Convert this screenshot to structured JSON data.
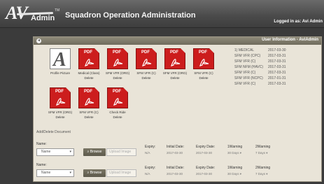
{
  "header": {
    "logo_big": "AV",
    "logo_small": "Admin",
    "logo_tm": "TM",
    "app_title": "Squadron Operation Administration",
    "login_text": "Logged in as: Avi Admin"
  },
  "panel": {
    "title": "User Information - AviAdmin",
    "control_glyph": "◂"
  },
  "documents": [
    {
      "label": "Profile Picture",
      "kind": "photo",
      "delete": ""
    },
    {
      "label": "Medical (Class)",
      "kind": "pdf",
      "delete": "Delete"
    },
    {
      "label": "SFM VFR (ORG)",
      "kind": "pdf",
      "delete": "Delete"
    },
    {
      "label": "SFM VFR (C)",
      "kind": "pdf",
      "delete": "Delete"
    },
    {
      "label": "SFM VFR (ORG)",
      "kind": "pdf",
      "delete": "Delete"
    },
    {
      "label": "SFM VFR (C)",
      "kind": "pdf",
      "delete": "Delete"
    },
    {
      "label": "SFM VFR (ORG)",
      "kind": "pdf",
      "delete": "Delete"
    },
    {
      "label": "SFM VFR (C)",
      "kind": "pdf",
      "delete": "Delete"
    },
    {
      "label": "Check Ride",
      "kind": "pdf",
      "delete": "Delete"
    }
  ],
  "pdf_tag": "PDF",
  "info_rows": [
    {
      "k": "1) MEDICAL",
      "v": "2017-03-30"
    },
    {
      "k": "SFM VFR (CPC)",
      "v": "2017-03-31"
    },
    {
      "k": "SFM VFR (C)",
      "v": "2017-03-31"
    },
    {
      "k": "SFM NFM (HAVC)",
      "v": "2017-03-31"
    },
    {
      "k": "SFM VFR (C)",
      "v": "2017-03-31"
    },
    {
      "k": "SFM VFR (NCPC)",
      "v": "2017-01-31"
    },
    {
      "k": "SFM VFR (C)",
      "v": "2017-03-31"
    }
  ],
  "section_label": "Add/Delete Document",
  "form_rows": [
    {
      "name_label": "Name:",
      "select_value": "Name",
      "browse_label": "Browse",
      "upload_placeholder": "Upload Image",
      "expiry_label": "Expiry:",
      "expiry_value": "N/A",
      "initial_label": "Initial Date:",
      "initial_value": "2017-03-30",
      "expiry_date_label": "Expiry Date:",
      "expiry_date_value": "2017-03-30",
      "warning1_label": "1Warning",
      "warning1_value": "30 Days",
      "warning2_label": "2Warning",
      "warning2_value": "7 Days"
    },
    {
      "name_label": "Name:",
      "select_value": "Name",
      "browse_label": "Browse",
      "upload_placeholder": "Upload Image",
      "expiry_label": "Expiry:",
      "expiry_value": "N/A",
      "initial_label": "Initial Date:",
      "initial_value": "2017-03-30",
      "expiry_date_label": "Expiry Date:",
      "expiry_date_value": "2017-03-30",
      "warning1_label": "1Warning",
      "warning1_value": "30 Days",
      "warning2_label": "2Warning",
      "warning2_value": "7 Days"
    }
  ],
  "icons": {
    "chevron": "▾",
    "search": "⌕"
  },
  "colors": {
    "header_bg": "#4a4a4a",
    "panel_bg": "#e9e4d8",
    "panel_bar": "#7d7968",
    "pdf_red": "#cc1d1d",
    "browse_btn": "#6b6858"
  }
}
